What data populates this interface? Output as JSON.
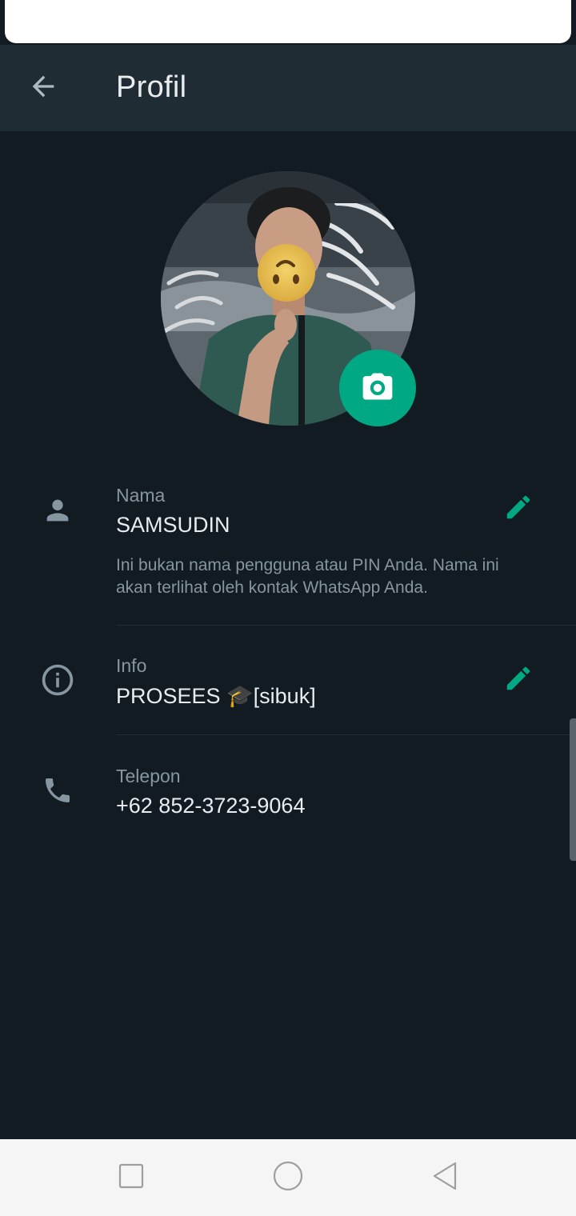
{
  "appbar": {
    "title": "Profil",
    "back_icon": "arrow-left-icon"
  },
  "profile": {
    "camera_icon": "camera-icon",
    "accent_color": "#00a884"
  },
  "name_row": {
    "icon": "person-icon",
    "label": "Nama",
    "value": "SAMSUDIN",
    "hint": "Ini bukan nama pengguna atau PIN Anda. Nama ini akan terlihat oleh kontak WhatsApp Anda.",
    "edit_icon": "pencil-icon"
  },
  "info_row": {
    "icon": "info-icon",
    "label": "Info",
    "value": "PROSEES 🎓[sibuk]",
    "edit_icon": "pencil-icon"
  },
  "phone_row": {
    "icon": "phone-icon",
    "label": "Telepon",
    "value": "+62 852-3723-9064"
  },
  "navbar": {
    "items": [
      "square-icon",
      "circle-icon",
      "triangle-back-icon"
    ]
  }
}
